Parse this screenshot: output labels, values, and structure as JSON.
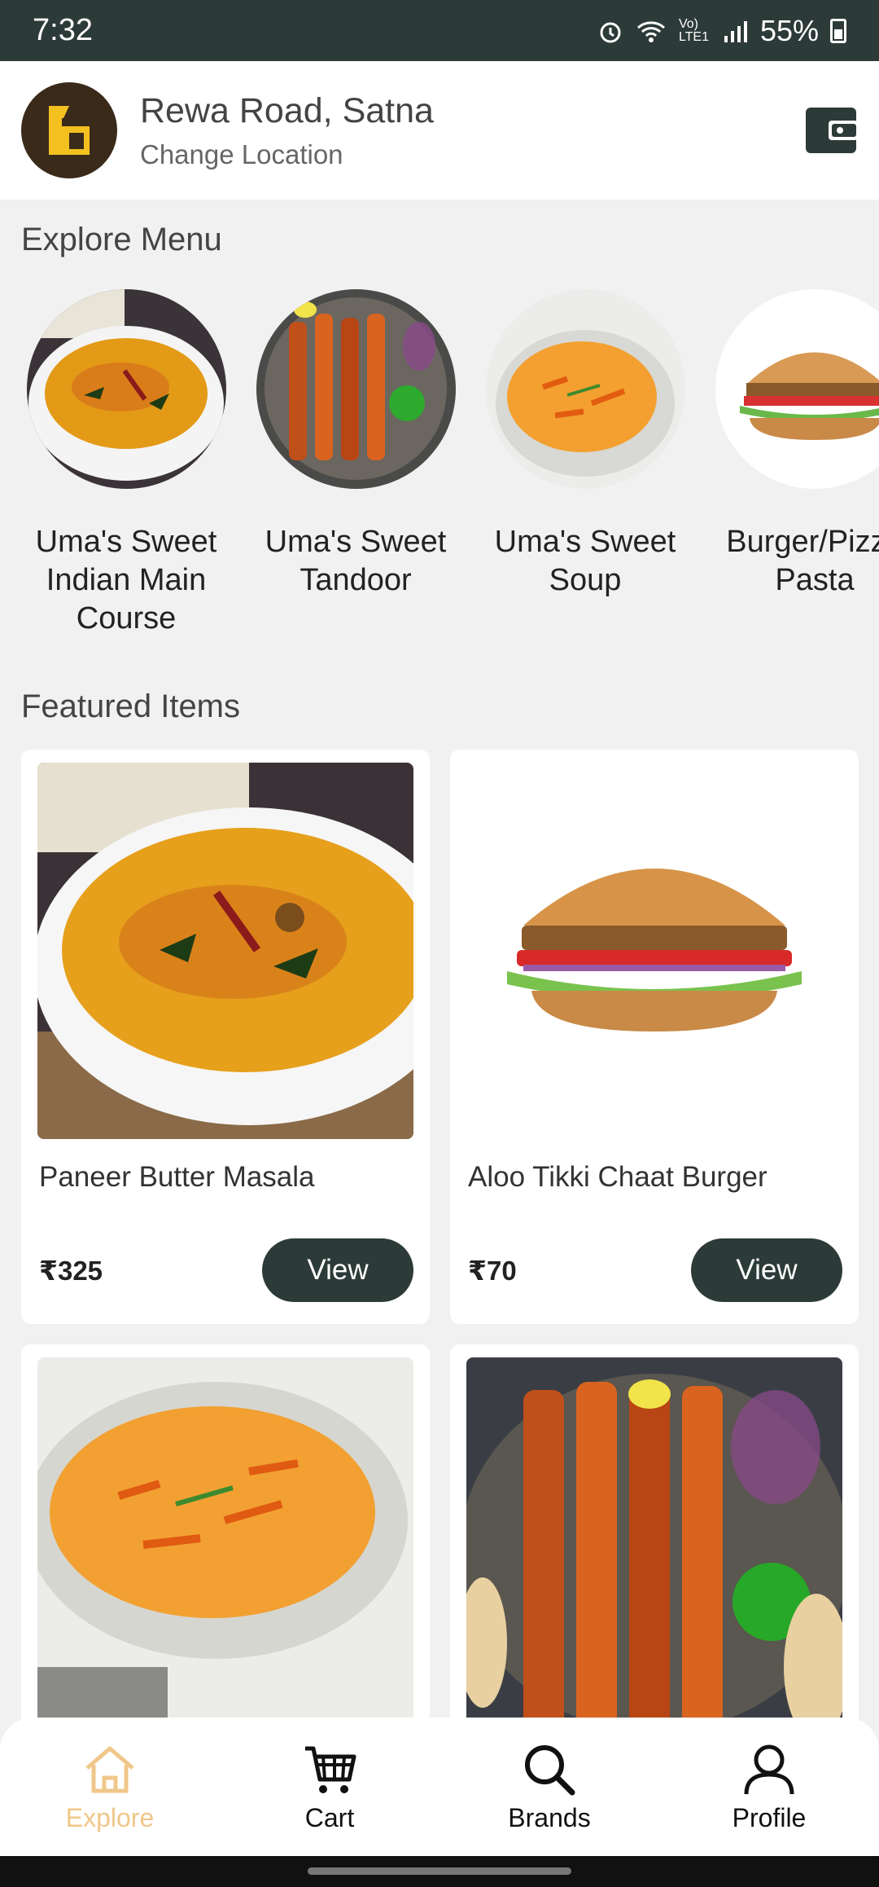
{
  "status_bar": {
    "time": "7:32",
    "battery": "55%",
    "network": "Vo) LTE1"
  },
  "header": {
    "location": "Rewa Road, Satna",
    "change_location": "Change Location"
  },
  "explore": {
    "title": "Explore Menu",
    "categories": [
      {
        "label": "Uma's Sweet Indian Main Course"
      },
      {
        "label": "Uma's Sweet Tandoor"
      },
      {
        "label": "Uma's Sweet Soup"
      },
      {
        "label": "Burger/Pizza Pasta"
      }
    ]
  },
  "featured": {
    "title": "Featured Items",
    "items": [
      {
        "name": "Paneer Butter Masala",
        "price": "₹325",
        "button": "View"
      },
      {
        "name": "Aloo Tikki Chaat Burger",
        "price": "₹70",
        "button": "View"
      }
    ]
  },
  "nav": {
    "items": [
      {
        "label": "Explore",
        "icon": "home-icon",
        "active": true
      },
      {
        "label": "Cart",
        "icon": "cart-icon"
      },
      {
        "label": "Brands",
        "icon": "search-icon"
      },
      {
        "label": "Profile",
        "icon": "user-icon"
      }
    ]
  },
  "colors": {
    "primary": "#2c3a38",
    "active_nav": "#f0c78a",
    "background": "#f1f1f1"
  }
}
